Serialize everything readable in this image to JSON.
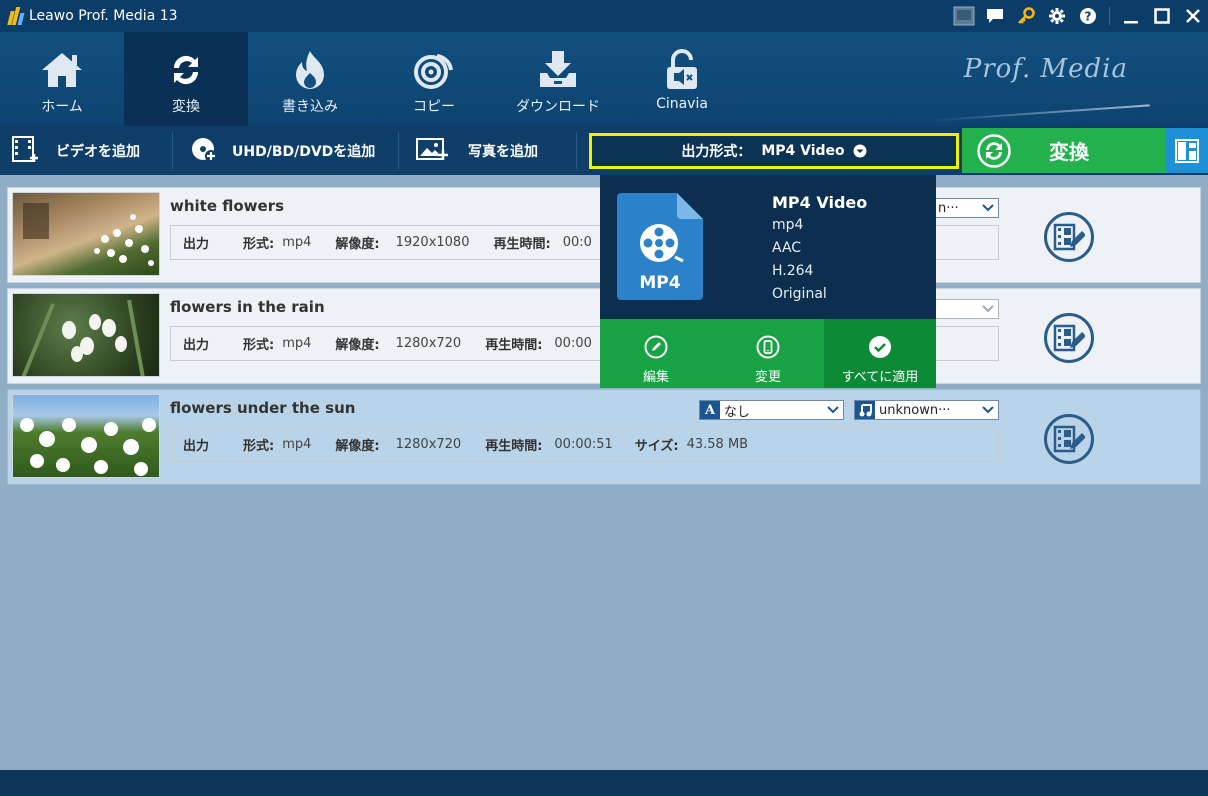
{
  "window": {
    "title": "Leawo Prof. Media 13"
  },
  "nav": {
    "items": [
      {
        "label": "ホーム",
        "icon": "home-icon"
      },
      {
        "label": "変換",
        "icon": "convert-icon",
        "active": true
      },
      {
        "label": "書き込み",
        "icon": "burn-icon"
      },
      {
        "label": "コピー",
        "icon": "copy-icon"
      },
      {
        "label": "ダウンロード",
        "icon": "download-icon"
      },
      {
        "label": "Cinavia",
        "icon": "cinavia-icon"
      }
    ],
    "brand": "Prof. Media"
  },
  "toolbar": {
    "add_video": "ビデオを追加",
    "add_disc": "UHD/BD/DVDを追加",
    "add_photo": "写真を追加",
    "format_label": "出力形式：",
    "format_value": "MP4 Video",
    "convert": "変換"
  },
  "labels": {
    "output": "出力",
    "format": "形式:",
    "resolution": "解像度:",
    "duration": "再生時間:",
    "size": "サイズ:"
  },
  "files": [
    {
      "title": "white flowers",
      "format": "mp4",
      "resolution": "1920x1080",
      "duration": "00:0",
      "subtitle_partial": "n···"
    },
    {
      "title": "flowers in the rain",
      "format": "mp4",
      "resolution": "1280x720",
      "duration": "00:00"
    },
    {
      "title": "flowers under the sun",
      "format": "mp4",
      "resolution": "1280x720",
      "duration": "00:00:51",
      "size": "43.58 MB",
      "subtitle": "なし",
      "audio": "unknown···",
      "selected": true
    }
  ],
  "popup": {
    "title": "MP4 Video",
    "container": "mp4",
    "audio_codec": "AAC",
    "video_codec": "H.264",
    "resolution": "Original",
    "badge": "MP4",
    "actions": {
      "edit": "編集",
      "change": "変更",
      "apply_all": "すべてに適用"
    }
  },
  "colors": {
    "accent_green": "#22b14c",
    "highlight": "#f2f200",
    "nav_bg": "#0d4370"
  }
}
